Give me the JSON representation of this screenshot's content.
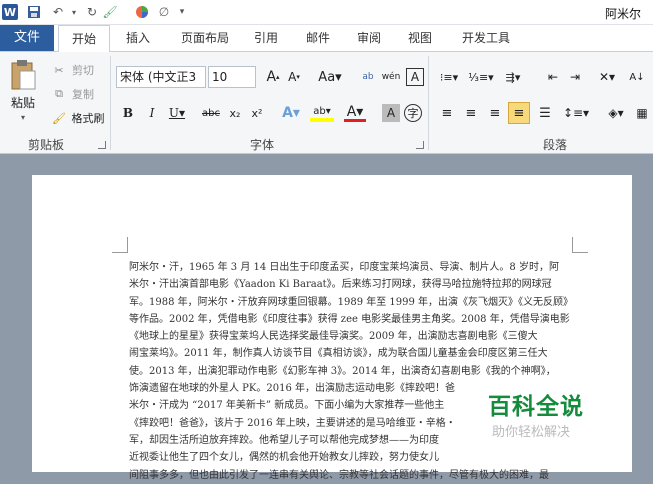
{
  "titlebar": {
    "app_title": "阿米尔",
    "word_logo": "W"
  },
  "tabs": [
    {
      "label": "文件"
    },
    {
      "label": "开始"
    },
    {
      "label": "插入"
    },
    {
      "label": "页面布局"
    },
    {
      "label": "引用"
    },
    {
      "label": "邮件"
    },
    {
      "label": "审阅"
    },
    {
      "label": "视图"
    },
    {
      "label": "开发工具"
    }
  ],
  "ribbon": {
    "clipboard": {
      "paste": "粘贴",
      "cut": "剪切",
      "copy": "复制",
      "format_painter": "格式刷",
      "group": "剪贴板"
    },
    "font": {
      "name": "宋体 (中文正3",
      "size": "10",
      "group": "字体"
    },
    "paragraph": {
      "group": "段落"
    }
  },
  "document": {
    "text_lines": [
      "阿米尔・汗，1965 年 3 月 14 日出生于印度孟买，印度宝莱坞演员、导演、制片人。8 岁时，阿",
      "米尔・汗出演首部电影《Yaadon Ki Baraat》。后来练习打网球，获得马哈拉施特拉邦的网球冠",
      "军。1988 年，阿米尔・汗放弃网球重回银幕。1989 年至 1999 年，出演《灰飞烟灭》《义无反顾》",
      "等作品。2002 年，凭借电影《印度往事》获得 zee 电影奖最佳男主角奖。2008 年，凭借导演电影",
      "《地球上的星星》获得宝莱坞人民选择奖最佳导演奖。2009 年，出演励志喜剧电影《三傻大",
      "闹宝莱坞》。2011 年，制作真人访谈节目《真相访谈》，成为联合国儿童基金会印度区第三任大",
      "使。2013 年，出演犯罪动作电影《幻影车神 3》。2014 年，出演奇幻喜剧电影《我的个神啊》，",
      "饰演遗留在地球的外星人 PK。2016 年，出演励志运动电影《摔跤吧！爸",
      "米尔・汗成为 “2017 年美新卡” 新成员。下面小编为大家推荐一些他主",
      "《摔跤吧！爸爸》，该片于 2016 年上映，主要讲述的是马哈维亚・辛格・",
      "军，却因生活所迫放弃摔跤。他希望儿子可以帮他完成梦想——为印度",
      "近视委让他生了四个女儿，偶然的机会他开始教女儿摔跤，努力使女儿",
      "间阻事多多，但也由此引发了一连串有关舆论、宗教等社会话题的事件，尽管有极大的困难，最"
    ]
  },
  "watermark": {
    "main": "百科全说",
    "sub": "助你轻松解决"
  }
}
